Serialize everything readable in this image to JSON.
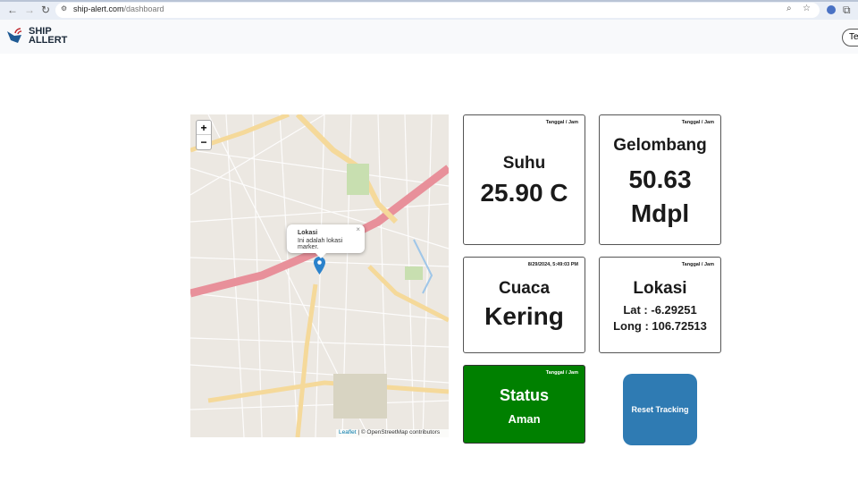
{
  "browser": {
    "url_host": "ship-alert.com",
    "url_path": "/dashboard"
  },
  "header": {
    "logo_line1": "SHIP",
    "logo_line2": "ALLERT",
    "right_button": "Ter"
  },
  "map": {
    "popup_title": "Lokasi",
    "popup_text": "Ini adalah lokasi marker.",
    "zoom_in": "+",
    "zoom_out": "−",
    "attribution_leaflet": "Leaflet",
    "attribution_rest": " | © OpenStreetMap contributors",
    "close": "×"
  },
  "cards": {
    "suhu": {
      "stamp": "Tanggal / Jam",
      "title": "Suhu",
      "value": "25.90 C"
    },
    "gelombang": {
      "stamp": "Tanggal / Jam",
      "title": "Gelombang",
      "value": "50.63",
      "unit": "Mdpl"
    },
    "cuaca": {
      "stamp": "8/29/2024, 5:49:03 PM",
      "title": "Cuaca",
      "value": "Kering"
    },
    "lokasi": {
      "stamp": "Tanggal / Jam",
      "title": "Lokasi",
      "lat": "Lat : -6.29251",
      "long": "Long : 106.72513"
    },
    "status": {
      "stamp": "Tanggal / Jam",
      "title": "Status",
      "value": "Aman",
      "color": "#008000"
    }
  },
  "reset_button": "Reset Tracking"
}
